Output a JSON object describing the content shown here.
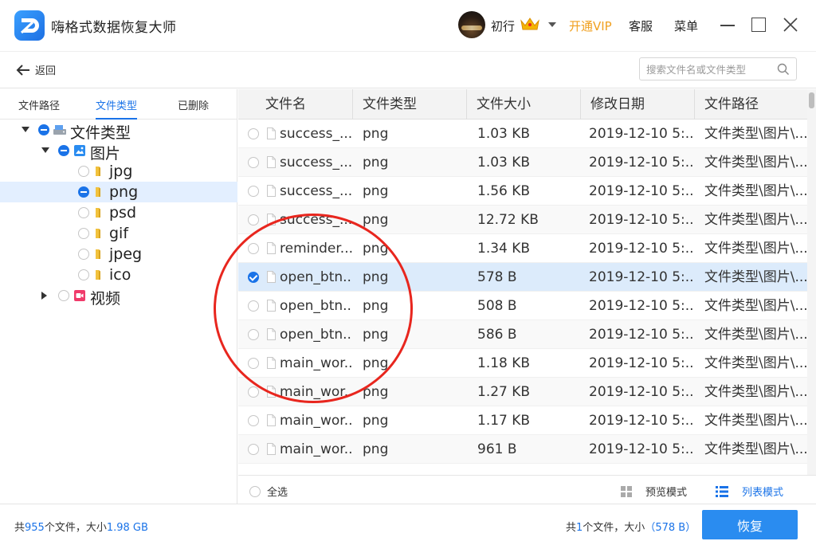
{
  "app": {
    "title": "嗨格式数据恢复大师"
  },
  "user": {
    "name": "初行",
    "vip_label": "开通VIP"
  },
  "header": {
    "service": "客服",
    "menu": "菜单"
  },
  "nav": {
    "back": "返回",
    "search_placeholder": "搜索文件名或文件类型"
  },
  "left_tabs": [
    "文件路径",
    "文件类型",
    "已删除"
  ],
  "tree": [
    {
      "label": "文件类型",
      "state": "partial",
      "icon": "drive-icon"
    },
    {
      "label": "图片",
      "state": "partial",
      "icon": "image-folder-icon"
    },
    {
      "label": "jpg",
      "state": "empty",
      "icon": "folder-icon"
    },
    {
      "label": "png",
      "state": "partial",
      "icon": "folder-icon",
      "selected": true
    },
    {
      "label": "psd",
      "state": "empty",
      "icon": "folder-icon"
    },
    {
      "label": "gif",
      "state": "empty",
      "icon": "folder-icon"
    },
    {
      "label": "jpeg",
      "state": "empty",
      "icon": "folder-icon"
    },
    {
      "label": "ico",
      "state": "empty",
      "icon": "folder-icon"
    },
    {
      "label": "视频",
      "state": "empty",
      "icon": "video-folder-icon"
    }
  ],
  "table": {
    "columns": [
      "文件名",
      "文件类型",
      "文件大小",
      "修改日期",
      "文件路径"
    ],
    "rows": [
      {
        "name": "success_...",
        "type": "png",
        "size": "1.03 KB",
        "date": "2019-12-10 5:...",
        "path": "文件类型\\图片\\...",
        "checked": false
      },
      {
        "name": "success_...",
        "type": "png",
        "size": "1.03 KB",
        "date": "2019-12-10 5:...",
        "path": "文件类型\\图片\\...",
        "checked": false
      },
      {
        "name": "success_...",
        "type": "png",
        "size": "1.56 KB",
        "date": "2019-12-10 5:...",
        "path": "文件类型\\图片\\...",
        "checked": false
      },
      {
        "name": "success_...",
        "type": "png",
        "size": "12.72 KB",
        "date": "2019-12-10 5:...",
        "path": "文件类型\\图片\\...",
        "checked": false
      },
      {
        "name": "reminder...",
        "type": "png",
        "size": "1.34 KB",
        "date": "2019-12-10 5:...",
        "path": "文件类型\\图片\\...",
        "checked": false
      },
      {
        "name": "open_btn...",
        "type": "png",
        "size": "578 B",
        "date": "2019-12-10 5:...",
        "path": "文件类型\\图片\\...",
        "checked": true
      },
      {
        "name": "open_btn...",
        "type": "png",
        "size": "508 B",
        "date": "2019-12-10 5:...",
        "path": "文件类型\\图片\\...",
        "checked": false
      },
      {
        "name": "open_btn...",
        "type": "png",
        "size": "586 B",
        "date": "2019-12-10 5:...",
        "path": "文件类型\\图片\\...",
        "checked": false
      },
      {
        "name": "main_wor...",
        "type": "png",
        "size": "1.18 KB",
        "date": "2019-12-10 5:...",
        "path": "文件类型\\图片\\...",
        "checked": false
      },
      {
        "name": "main_wor...",
        "type": "png",
        "size": "1.27 KB",
        "date": "2019-12-10 5:...",
        "path": "文件类型\\图片\\...",
        "checked": false
      },
      {
        "name": "main_wor...",
        "type": "png",
        "size": "1.17 KB",
        "date": "2019-12-10 5:...",
        "path": "文件类型\\图片\\...",
        "checked": false
      },
      {
        "name": "main_wor...",
        "type": "png",
        "size": "961 B",
        "date": "2019-12-10 5:...",
        "path": "文件类型\\图片\\...",
        "checked": false
      }
    ]
  },
  "footer": {
    "select_all": "全选",
    "preview_mode": "预览模式",
    "list_mode": "列表模式"
  },
  "status": {
    "total_prefix": "共",
    "total_count": "955",
    "total_mid": "个文件，大小",
    "total_size": "1.98 GB",
    "sel_prefix": "共",
    "sel_count": "1",
    "sel_mid": "个文件，大小",
    "sel_size": "（578 B）"
  },
  "recover_button": "恢复",
  "colors": {
    "accent": "#1a73e8",
    "vip": "#f0a020",
    "button": "#2a8cf0",
    "annotation": "#e8261e"
  }
}
